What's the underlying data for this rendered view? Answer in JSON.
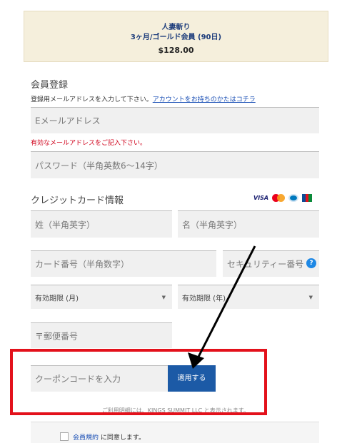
{
  "plan": {
    "name": "人妻斬り",
    "term": "3ヶ月/ゴールド会員 (90日)",
    "price": "$128.00"
  },
  "registration": {
    "title": "会員登録",
    "hint_text": "登録用メールアドレスを入力して下さい。",
    "hint_link": "アカウントをお持ちのかたはコチラ",
    "email_placeholder": "Eメールアドレス",
    "email_error": "有効なメールアドレスをご記入下さい。",
    "password_placeholder": "パスワード（半角英数6～14字）"
  },
  "credit_card": {
    "title": "クレジットカード情報",
    "card_icons": [
      "visa-icon",
      "mastercard-icon",
      "diners-icon",
      "jcb-icon"
    ],
    "visa_label": "VISA",
    "last_name_placeholder": "姓（半角英字）",
    "first_name_placeholder": "名（半角英字）",
    "card_number_placeholder": "カード番号（半角数字）",
    "security_code_placeholder": "セキュリティー番号",
    "help_label": "?",
    "expiry_month_placeholder": "有効期限 (月)",
    "expiry_year_placeholder": "有効期限 (年)",
    "postal_code_placeholder": "〒郵便番号"
  },
  "coupon": {
    "placeholder": "クーポンコードを入力",
    "apply_label": "適用する",
    "billing_note": "ご利用明細には、KINGS SUMMIT LLC と表示されます。"
  },
  "terms": {
    "link": "会員規約",
    "text": " に同意します。"
  },
  "colors": {
    "plan_bg": "#f5efdc",
    "primary_button": "#1c5aa6",
    "error": "#d0021b",
    "highlight_frame": "#e3111b",
    "help_icon": "#1e88e5"
  }
}
